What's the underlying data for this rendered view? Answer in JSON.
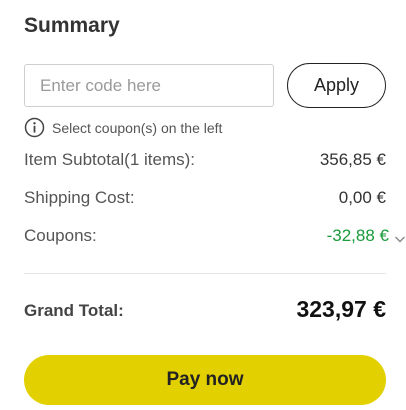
{
  "summary": {
    "title": "Summary"
  },
  "coupon": {
    "placeholder": "Enter code here",
    "value": "",
    "apply_label": "Apply",
    "hint": "Select coupon(s) on the left"
  },
  "lines": {
    "subtotal_label": "Item Subtotal(1 items):",
    "subtotal_value": "356,85 €",
    "shipping_label": "Shipping Cost:",
    "shipping_value": "0,00 €",
    "coupons_label": "Coupons:",
    "coupons_value": "-32,88 €"
  },
  "total": {
    "label": "Grand Total:",
    "value": "323,97 €"
  },
  "actions": {
    "pay_label": "Pay now"
  },
  "colors": {
    "accent_button": "#e3d000",
    "discount_green": "#1a9b3a"
  },
  "icons": {
    "hint": "info-icon",
    "coupons_toggle": "chevron-down-icon"
  }
}
